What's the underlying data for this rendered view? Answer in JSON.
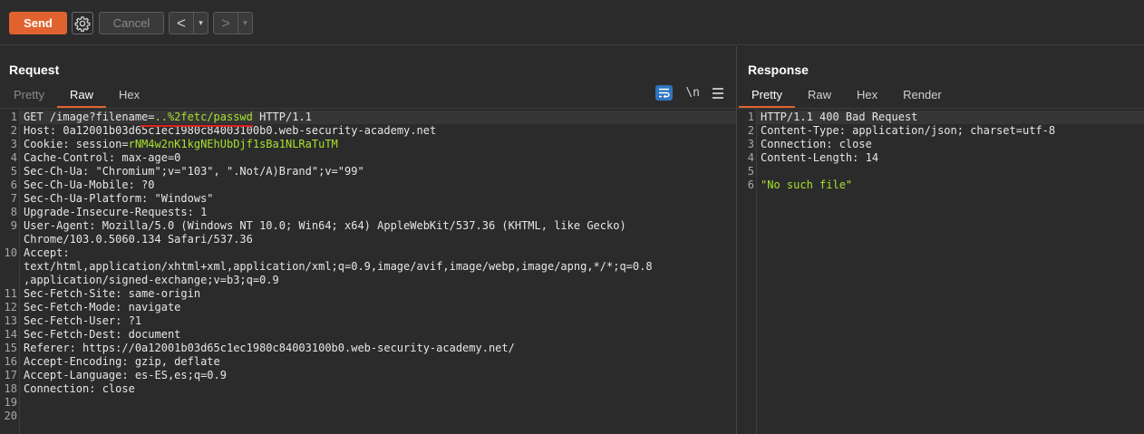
{
  "toolbar": {
    "send_label": "Send",
    "cancel_label": "Cancel",
    "back_symbol": "<",
    "forward_symbol": ">",
    "dropdown_symbol": "▾",
    "accent_color": "#e0632f"
  },
  "request": {
    "title": "Request",
    "tabs": [
      {
        "label": "Pretty",
        "state": "dim"
      },
      {
        "label": "Raw",
        "state": "active"
      },
      {
        "label": "Hex",
        "state": "normal"
      }
    ],
    "tool_newline": "\\n",
    "lines": [
      {
        "n": "1",
        "parts": [
          {
            "t": "GET /image?filename=",
            "c": "k"
          },
          {
            "t": "..%2fetc/passwd",
            "c": "hl",
            "cursor": true
          },
          {
            "t": " HTTP/1.1",
            "c": "k"
          }
        ]
      },
      {
        "n": "2",
        "parts": [
          {
            "t": "Host: ",
            "c": "k"
          },
          {
            "t": "0a12001b03d65c1ec1980c84003100b0.web-security-academy.net",
            "c": "v"
          }
        ]
      },
      {
        "n": "3",
        "parts": [
          {
            "t": "Cookie: ",
            "c": "k"
          },
          {
            "t": "session=",
            "c": "v"
          },
          {
            "t": "rNM4w2nK1kgNEhUbDjf1sBa1NLRaTuTM",
            "c": "hl"
          }
        ]
      },
      {
        "n": "4",
        "parts": [
          {
            "t": "Cache-Control: max-age=0",
            "c": "k"
          }
        ]
      },
      {
        "n": "5",
        "parts": [
          {
            "t": "Sec-Ch-Ua: \"Chromium\";v=\"103\", \".Not/A)Brand\";v=\"99\"",
            "c": "k"
          }
        ]
      },
      {
        "n": "6",
        "parts": [
          {
            "t": "Sec-Ch-Ua-Mobile: ?0",
            "c": "k"
          }
        ]
      },
      {
        "n": "7",
        "parts": [
          {
            "t": "Sec-Ch-Ua-Platform: \"Windows\"",
            "c": "k"
          }
        ]
      },
      {
        "n": "8",
        "parts": [
          {
            "t": "Upgrade-Insecure-Requests: 1",
            "c": "k"
          }
        ]
      },
      {
        "n": "9",
        "parts": [
          {
            "t": "User-Agent: Mozilla/5.0 (Windows NT 10.0; Win64; x64) AppleWebKit/537.36 (KHTML, like Gecko)",
            "c": "k"
          }
        ]
      },
      {
        "n": "",
        "parts": [
          {
            "t": "Chrome/103.0.5060.134 Safari/537.36",
            "c": "k"
          }
        ]
      },
      {
        "n": "10",
        "parts": [
          {
            "t": "Accept:",
            "c": "k"
          }
        ]
      },
      {
        "n": "",
        "parts": [
          {
            "t": "text/html,application/xhtml+xml,application/xml;q=0.9,image/avif,image/webp,image/apng,*/*;q=0.8",
            "c": "k"
          }
        ]
      },
      {
        "n": "",
        "parts": [
          {
            "t": ",application/signed-exchange;v=b3;q=0.9",
            "c": "k"
          }
        ]
      },
      {
        "n": "11",
        "parts": [
          {
            "t": "Sec-Fetch-Site: same-origin",
            "c": "k"
          }
        ]
      },
      {
        "n": "12",
        "parts": [
          {
            "t": "Sec-Fetch-Mode: navigate",
            "c": "k"
          }
        ]
      },
      {
        "n": "13",
        "parts": [
          {
            "t": "Sec-Fetch-User: ?1",
            "c": "k"
          }
        ]
      },
      {
        "n": "14",
        "parts": [
          {
            "t": "Sec-Fetch-Dest: document",
            "c": "k"
          }
        ]
      },
      {
        "n": "15",
        "parts": [
          {
            "t": "Referer: https://0a12001b03d65c1ec1980c84003100b0.web-security-academy.net/",
            "c": "k"
          }
        ]
      },
      {
        "n": "16",
        "parts": [
          {
            "t": "Accept-Encoding: gzip, deflate",
            "c": "k"
          }
        ]
      },
      {
        "n": "17",
        "parts": [
          {
            "t": "Accept-Language: es-ES,es;q=0.9",
            "c": "k"
          }
        ]
      },
      {
        "n": "18",
        "parts": [
          {
            "t": "Connection: close",
            "c": "k"
          }
        ]
      },
      {
        "n": "19",
        "parts": []
      },
      {
        "n": "20",
        "parts": []
      }
    ]
  },
  "response": {
    "title": "Response",
    "tabs": [
      {
        "label": "Pretty",
        "state": "active"
      },
      {
        "label": "Raw",
        "state": "normal"
      },
      {
        "label": "Hex",
        "state": "normal"
      },
      {
        "label": "Render",
        "state": "normal"
      }
    ],
    "lines": [
      {
        "n": "1",
        "parts": [
          {
            "t": "HTTP/1.1 400 Bad Request",
            "c": "k"
          }
        ]
      },
      {
        "n": "2",
        "parts": [
          {
            "t": "Content-Type: application/json; charset=utf-8",
            "c": "k"
          }
        ]
      },
      {
        "n": "3",
        "parts": [
          {
            "t": "Connection: close",
            "c": "k"
          }
        ]
      },
      {
        "n": "4",
        "parts": [
          {
            "t": "Content-Length: 14",
            "c": "k"
          }
        ]
      },
      {
        "n": "5",
        "parts": []
      },
      {
        "n": "6",
        "parts": [
          {
            "t": "\"No such file\"",
            "c": "hl"
          }
        ]
      }
    ]
  }
}
